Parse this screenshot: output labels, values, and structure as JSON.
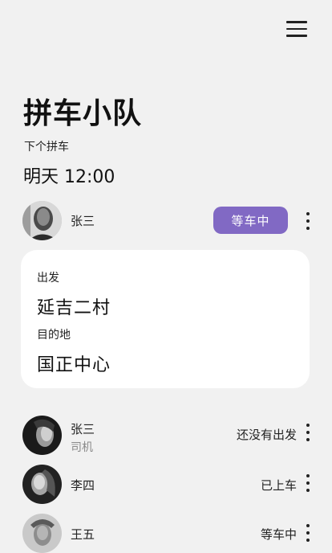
{
  "header": {
    "menu_icon": "hamburger-menu-icon"
  },
  "page_title": "拼车小队",
  "next_ride": {
    "label": "下个拼车",
    "time": "明天 12:00"
  },
  "host": {
    "name": "张三",
    "status": "等车中"
  },
  "route": {
    "departure_label": "出发",
    "departure": "延吉二村",
    "destination_label": "目的地",
    "destination": "国正中心"
  },
  "members": [
    {
      "name": "张三",
      "role": "司机",
      "status": "还没有出发"
    },
    {
      "name": "李四",
      "status": "已上车"
    },
    {
      "name": "王五",
      "status": "等车中"
    }
  ],
  "colors": {
    "accent": "#8169c4",
    "background": "#f1f1f1",
    "card": "#ffffff"
  }
}
